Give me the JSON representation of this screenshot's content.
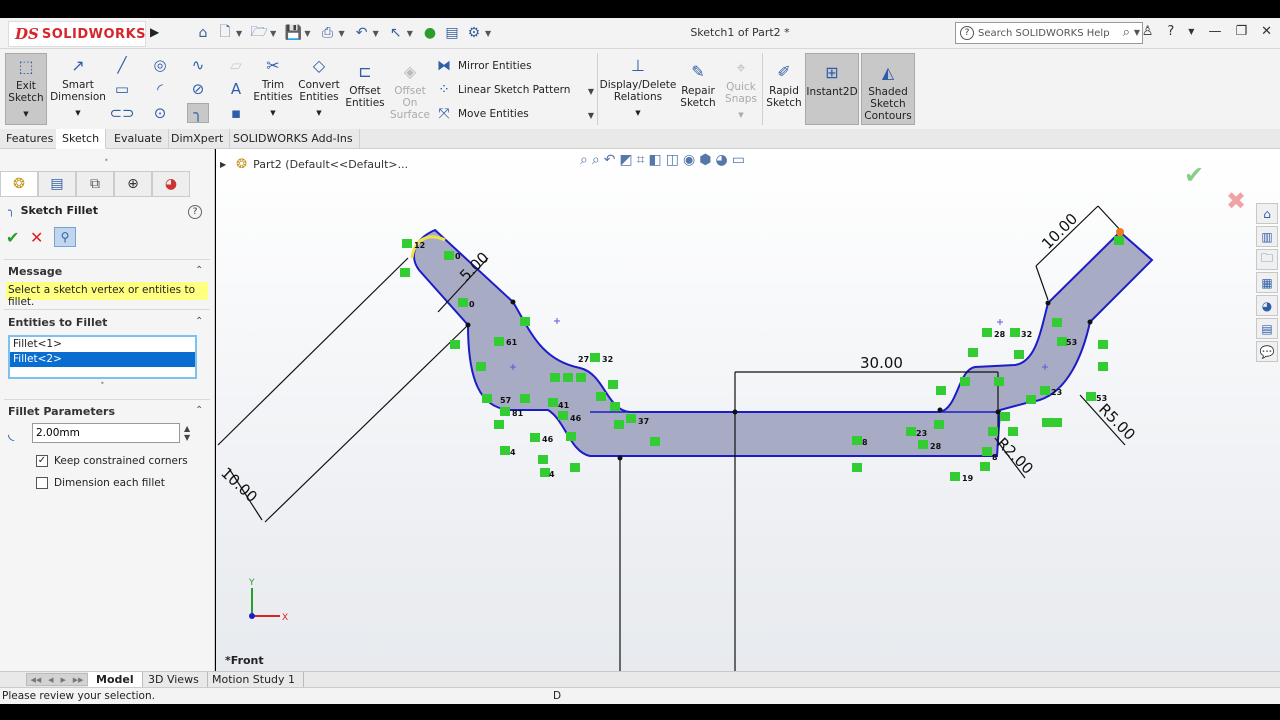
{
  "app": {
    "logo_ds": "DS",
    "logo_text": "SOLIDWORKS",
    "doc_title": "Sketch1 of Part2 *",
    "search_placeholder": "Search SOLIDWORKS Help"
  },
  "ribbon": {
    "exit_sketch": "Exit Sketch",
    "smart_dimension": "Smart Dimension",
    "trim_entities": "Trim Entities",
    "convert_entities": "Convert Entities",
    "offset_entities": "Offset Entities",
    "offset_on_surface": "Offset On Surface",
    "mirror_entities": "Mirror Entities",
    "linear_sketch_pattern": "Linear Sketch Pattern",
    "move_entities": "Move Entities",
    "display_delete_relations": "Display/Delete Relations",
    "repair_sketch": "Repair Sketch",
    "quick_snaps": "Quick Snaps",
    "rapid_sketch": "Rapid Sketch",
    "instant2d": "Instant2D",
    "shaded_sketch_contours": "Shaded Sketch Contours"
  },
  "tabs": [
    "Features",
    "Sketch",
    "Evaluate",
    "DimXpert",
    "SOLIDWORKS Add-Ins"
  ],
  "active_tab": "Sketch",
  "property_manager": {
    "title": "Sketch Fillet",
    "message_header": "Message",
    "message_text": "Select a sketch vertex or entities to fillet.",
    "entities_header": "Entities to Fillet",
    "entities": [
      "Fillet<1>",
      "Fillet<2>"
    ],
    "selected_entity": "Fillet<2>",
    "params_header": "Fillet Parameters",
    "radius_value": "2.00mm",
    "keep_corners_label": "Keep constrained corners",
    "keep_corners_checked": true,
    "dimension_each_label": "Dimension each fillet",
    "dimension_each_checked": false
  },
  "graphics": {
    "tree_label": "Part2  (Default<<Default>...",
    "view_label": "*Front",
    "dimensions": {
      "d1": "5.00",
      "d2": "10.00",
      "d3": "30.00",
      "d4": "10.00",
      "d5": "R5.00",
      "d6": "R2.00"
    },
    "relation_numbers": [
      "12",
      "0",
      "0",
      "61",
      "57",
      "81",
      "41",
      "46",
      "46",
      "4",
      "4",
      "37",
      "27",
      "32",
      "28",
      "32",
      "53",
      "23",
      "53",
      "23",
      "28",
      "8",
      "19",
      "8"
    ],
    "triad_y": "Y",
    "triad_x": "X"
  },
  "bottom_tabs": [
    "Model",
    "3D Views",
    "Motion Study 1"
  ],
  "active_bottom_tab": "Model",
  "status": {
    "message": "Please review your selection.",
    "indicator": "D"
  },
  "colors": {
    "sketch_line": "#1c1cc8",
    "shaded_fill": "#a8abc4",
    "relation_green": "#33cc33",
    "message_yellow": "#ffff80",
    "selection_blue": "#0a6ed1",
    "brand_red": "#d6262b"
  }
}
